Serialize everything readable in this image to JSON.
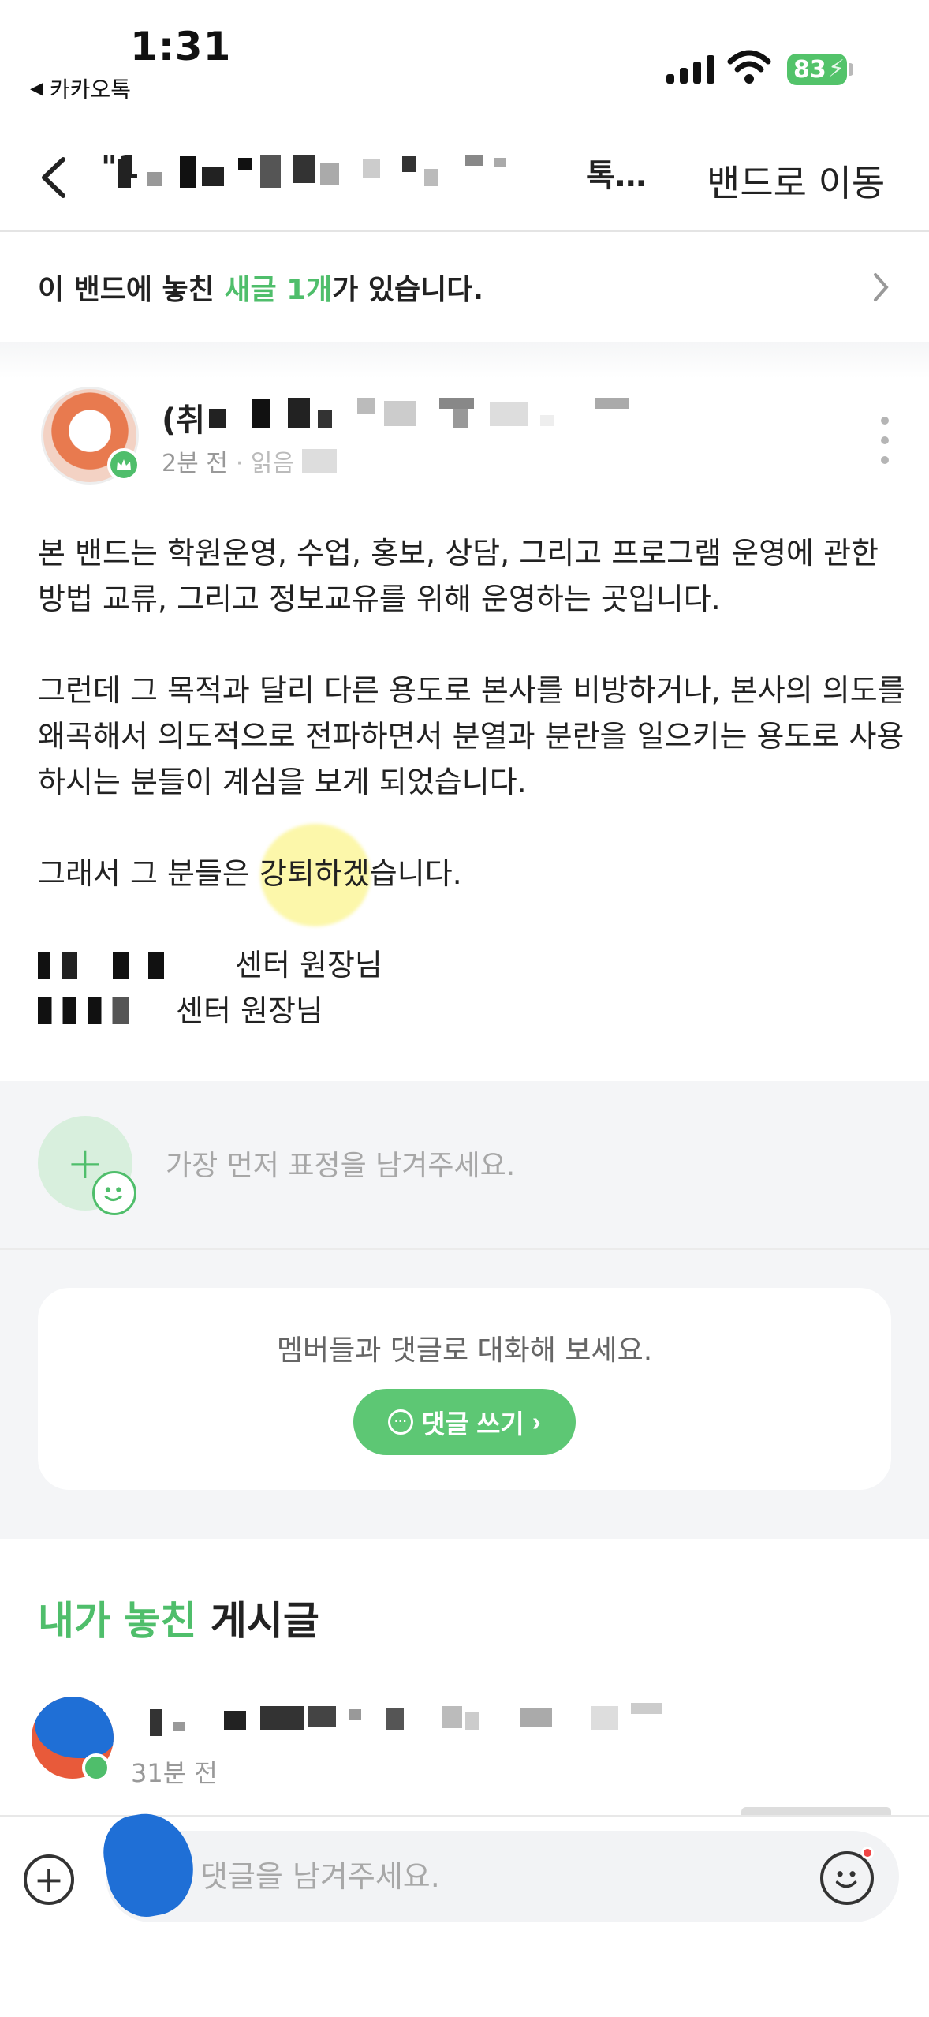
{
  "status_bar": {
    "time": "1:31",
    "back_app": "카카오톡",
    "battery": "83"
  },
  "nav": {
    "title_visible": "\"1",
    "title_suffix": "톡…",
    "move_to_band": "밴드로 이동"
  },
  "banner": {
    "prefix": "이 밴드에 놓친 ",
    "highlight": "새글 1개",
    "suffix": "가 있습니다."
  },
  "post": {
    "author_prefix": "(취",
    "time": "2분 전",
    "meta_sep": "· 읽음",
    "paragraph1": "본 밴드는 학원운영, 수업, 홍보, 상담, 그리고 프로그램 운영에 관한 방법 교류, 그리고 정보교유를 위해 운영하는 곳입니다.",
    "paragraph2": "그런데 그 목적과 달리 다른 용도로 본사를 비방하거나, 본사의 의도를 왜곡해서 의도적으로 전파하면서 분열과 분란을 일으키는 용도로 사용하시는 분들이 계심을 보게 되었습니다.",
    "paragraph3": "그래서 그 분들은 강퇴하겠습니다.",
    "signature1": "센터 원장님",
    "signature2": "센터 원장님"
  },
  "reactions": {
    "prompt": "가장 먼저 표정을 남겨주세요."
  },
  "comments": {
    "prompt": "멤버들과 댓글로 대화해 보세요.",
    "button": "댓글 쓰기"
  },
  "missed": {
    "title_highlight": "내가 놓친",
    "title_rest": " 게시글",
    "item_time": "31분 전"
  },
  "bottom_bar": {
    "input_placeholder": "댓글을 남겨주세요."
  },
  "icons": {
    "back": "chevron-left-icon",
    "banner_arrow": "chevron-right-icon",
    "more": "more-vertical-icon",
    "add_reaction": "plus-icon",
    "smile": "smile-icon",
    "comment": "chat-bubble-icon",
    "attach": "plus-circle-icon",
    "emoji": "emoji-icon"
  },
  "colors": {
    "accent_green": "#4fbe6b",
    "button_green": "#5dc774",
    "highlight_yellow": "#faf064"
  }
}
